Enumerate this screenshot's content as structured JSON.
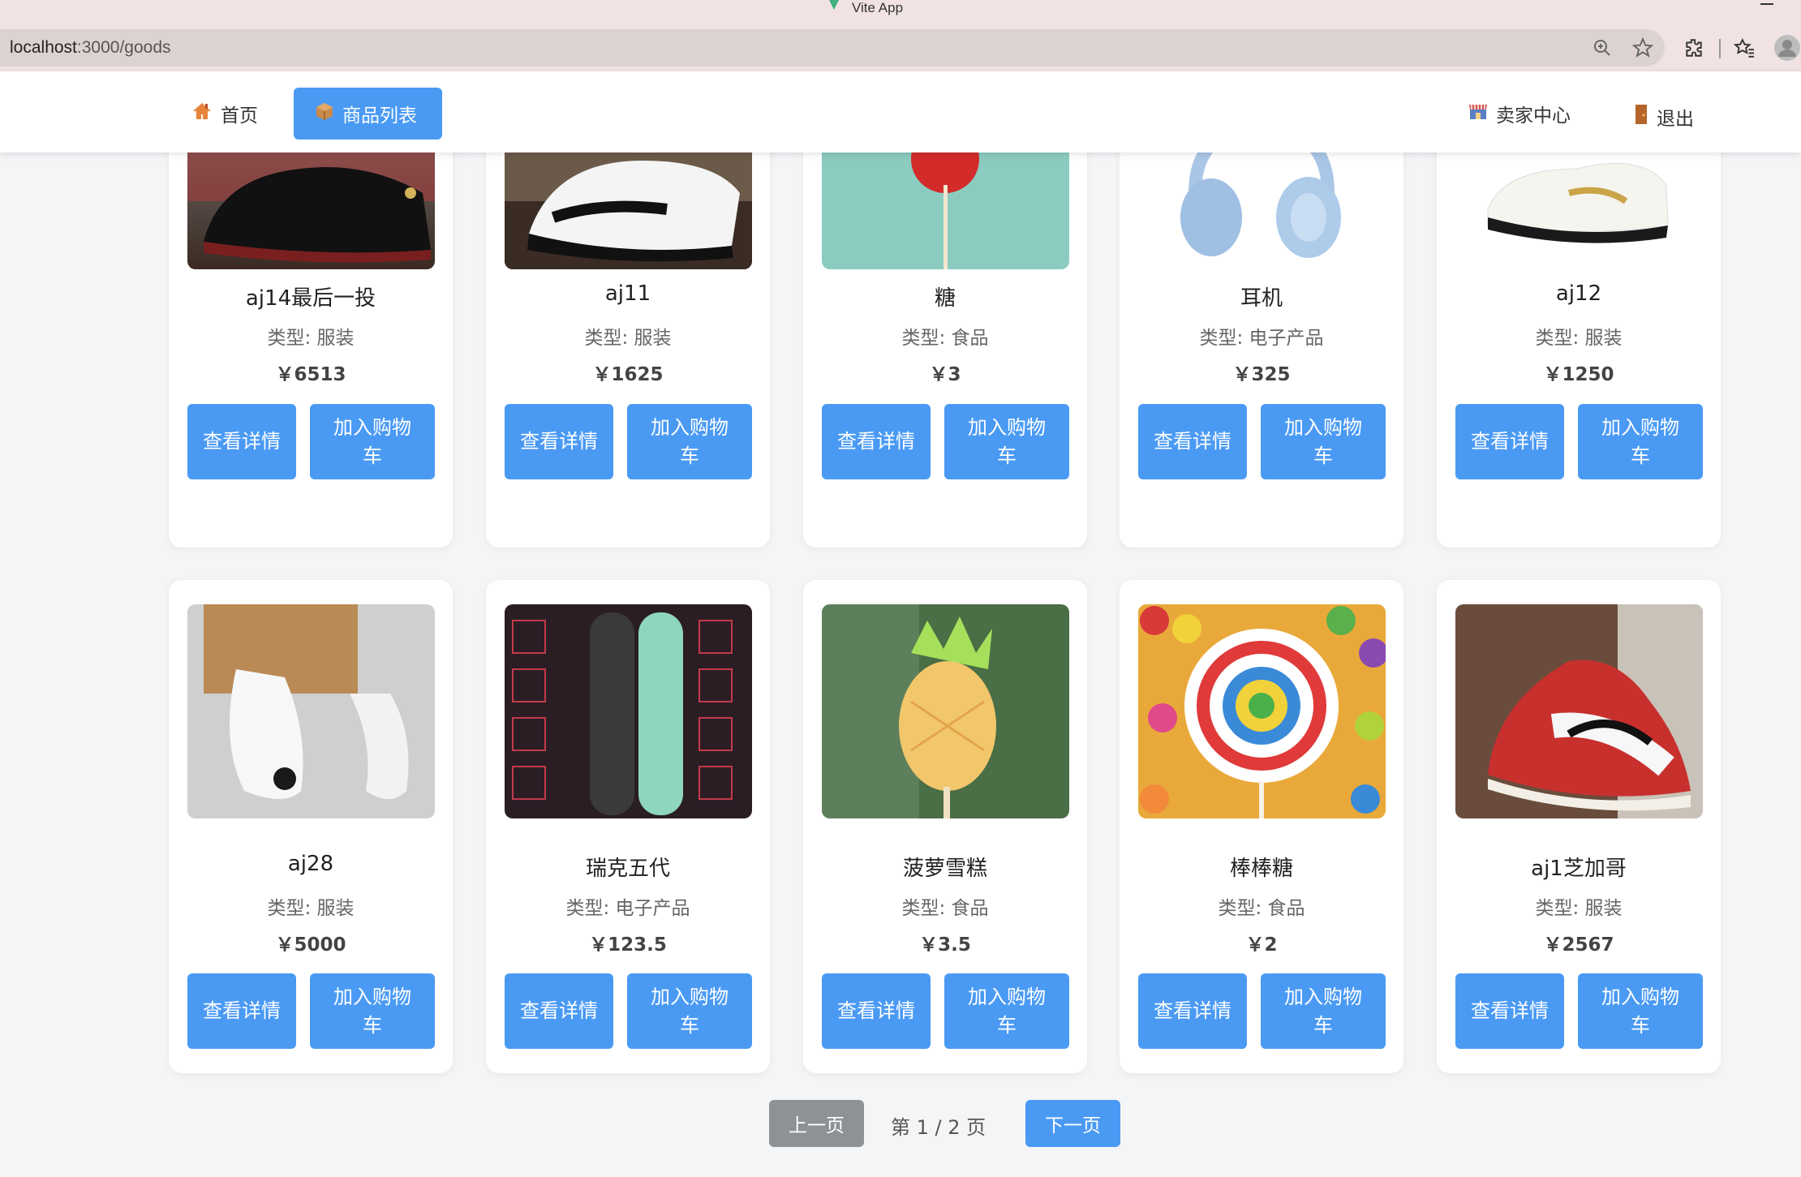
{
  "window": {
    "title": "Vite App"
  },
  "browser": {
    "url_host": "localhost",
    "url_path": ":3000/goods"
  },
  "nav": {
    "home_label": "首页",
    "goods_label": "商品列表",
    "seller_label": "卖家中心",
    "logout_label": "退出"
  },
  "products": [
    {
      "name": "aj14最后一投",
      "type": "类型: 服装",
      "price": "￥6513"
    },
    {
      "name": "aj11",
      "type": "类型: 服装",
      "price": "￥1625"
    },
    {
      "name": "糖",
      "type": "类型: 食品",
      "price": "￥3"
    },
    {
      "name": "耳机",
      "type": "类型: 电子产品",
      "price": "￥325"
    },
    {
      "name": "aj12",
      "type": "类型: 服装",
      "price": "￥1250"
    },
    {
      "name": "aj28",
      "type": "类型: 服装",
      "price": "￥5000"
    },
    {
      "name": "瑞克五代",
      "type": "类型: 电子产品",
      "price": "￥123.5"
    },
    {
      "name": "菠萝雪糕",
      "type": "类型: 食品",
      "price": "￥3.5"
    },
    {
      "name": "棒棒糖",
      "type": "类型: 食品",
      "price": "￥2"
    },
    {
      "name": "aj1芝加哥",
      "type": "类型: 服装",
      "price": "￥2567"
    }
  ],
  "buttons": {
    "detail": "查看详情",
    "cart": "加入购物车"
  },
  "pagination": {
    "prev": "上一页",
    "info": "第 1 / 2 页",
    "next": "下一页"
  },
  "colors": {
    "accent": "#4a9af4",
    "disabled": "#8e9296",
    "background": "#f4f5f7"
  }
}
